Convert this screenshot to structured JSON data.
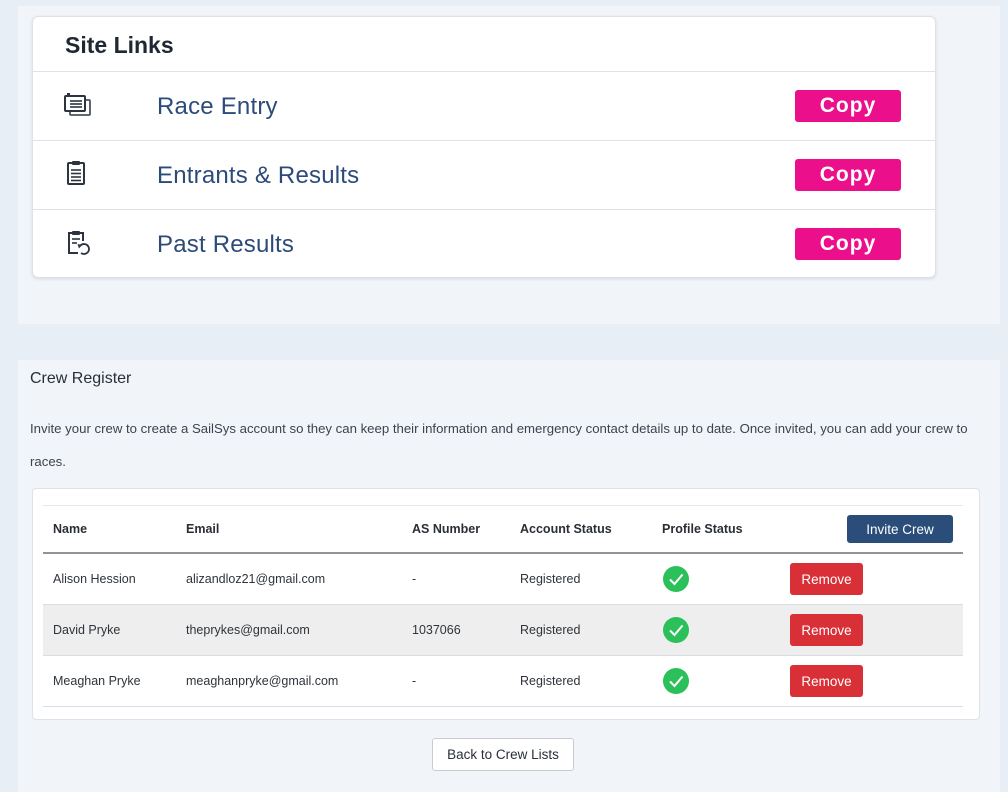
{
  "site_links": {
    "title": "Site Links",
    "items": [
      {
        "label": "Race Entry",
        "icon": "ticket-icon",
        "action": "Copy"
      },
      {
        "label": "Entrants & Results",
        "icon": "clipboard-list-icon",
        "action": "Copy"
      },
      {
        "label": "Past Results",
        "icon": "clipboard-history-icon",
        "action": "Copy"
      }
    ],
    "copy_color": "#ec0f8c"
  },
  "crew_register": {
    "title": "Crew Register",
    "description": "Invite your crew to create a SailSys account so they can keep their information and emergency contact details up to date. Once invited, you can add your crew to races.",
    "columns": [
      "Name",
      "Email",
      "AS Number",
      "Account Status",
      "Profile Status"
    ],
    "invite_label": "Invite Crew",
    "remove_label": "Remove",
    "rows": [
      {
        "name": "Alison Hession",
        "email": "alizandloz21@gmail.com",
        "as_number": "-",
        "account_status": "Registered"
      },
      {
        "name": "David Pryke",
        "email": "theprykes@gmail.com",
        "as_number": "1037066",
        "account_status": "Registered"
      },
      {
        "name": "Meaghan Pryke",
        "email": "meaghanpryke@gmail.com",
        "as_number": "-",
        "account_status": "Registered"
      }
    ],
    "back_label": "Back to Crew Lists",
    "colors": {
      "invite": "#2a4d7a",
      "remove": "#d92f36",
      "check": "#2cc05a"
    }
  }
}
